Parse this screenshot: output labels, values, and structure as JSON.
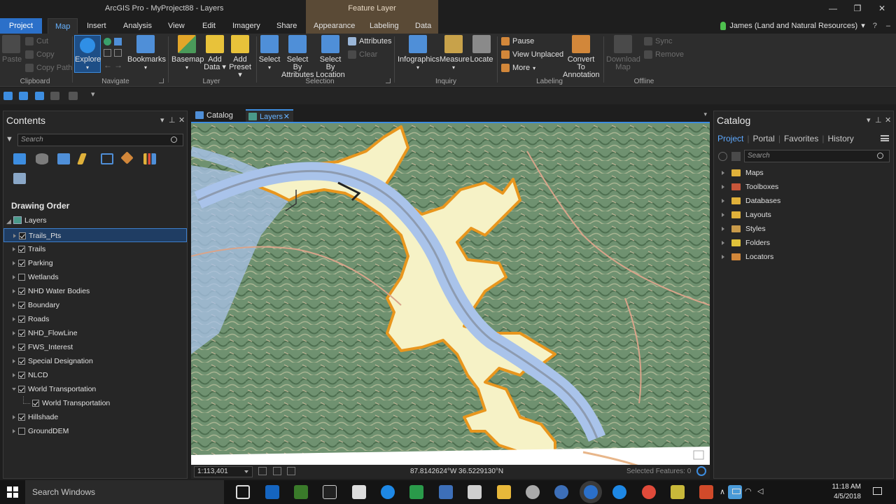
{
  "window": {
    "title": "ArcGIS Pro - MyProject88 - Layers",
    "context_group": "Feature Layer",
    "controls": {
      "minimize": "—",
      "restore": "❐",
      "close": "✕"
    }
  },
  "tabs": [
    "Project",
    "Map",
    "Insert",
    "Analysis",
    "View",
    "Edit",
    "Imagery",
    "Share",
    "Appearance",
    "Labeling",
    "Data"
  ],
  "active_tab": "Map",
  "user": {
    "name": "James (Land and Natural Resources)"
  },
  "ribbon": {
    "clipboard": {
      "paste": "Paste",
      "cut": "Cut",
      "copy": "Copy",
      "copy_path": "Copy Path",
      "label": "Clipboard"
    },
    "navigate": {
      "explore": "Explore",
      "bookmarks": "Bookmarks",
      "label": "Navigate"
    },
    "layer": {
      "basemap": "Basemap",
      "add_data_1": "Add",
      "add_data_2": "Data",
      "add_preset_1": "Add",
      "add_preset_2": "Preset",
      "label": "Layer"
    },
    "selection": {
      "select": "Select",
      "select_by_attr_1": "Select By",
      "select_by_attr_2": "Attributes",
      "select_by_loc_1": "Select By",
      "select_by_loc_2": "Location",
      "attributes": "Attributes",
      "clear": "Clear",
      "label": "Selection"
    },
    "inquiry": {
      "infographics": "Infographics",
      "measure": "Measure",
      "locate": "Locate",
      "label": "Inquiry"
    },
    "labeling": {
      "pause": "Pause",
      "view_unplaced": "View Unplaced",
      "more": "More",
      "convert_1": "Convert To",
      "convert_2": "Annotation",
      "label": "Labeling"
    },
    "offline": {
      "download_1": "Download",
      "download_2": "Map",
      "sync": "Sync",
      "remove": "Remove",
      "label": "Offline"
    }
  },
  "contents": {
    "title": "Contents",
    "search_placeholder": "Search",
    "section": "Drawing Order",
    "root": "Layers",
    "layers": [
      {
        "name": "Trails_Pts",
        "checked": true,
        "selected": true
      },
      {
        "name": "Trails",
        "checked": true
      },
      {
        "name": "Parking",
        "checked": true
      },
      {
        "name": "Wetlands",
        "checked": false
      },
      {
        "name": "NHD Water Bodies",
        "checked": true
      },
      {
        "name": "Boundary",
        "checked": true
      },
      {
        "name": "Roads",
        "checked": true
      },
      {
        "name": "NHD_FlowLine",
        "checked": true
      },
      {
        "name": "FWS_Interest",
        "checked": true
      },
      {
        "name": "Special Designation",
        "checked": true
      },
      {
        "name": "NLCD",
        "checked": true
      },
      {
        "name": "World Transportation",
        "checked": true,
        "expanded": true
      },
      {
        "name": "World Transportation",
        "checked": true,
        "child": true
      },
      {
        "name": "Hillshade",
        "checked": true
      },
      {
        "name": "GroundDEM",
        "checked": false
      }
    ]
  },
  "views": {
    "tabs": [
      {
        "label": "Catalog"
      },
      {
        "label": "Layers",
        "active": true
      }
    ]
  },
  "status": {
    "scale": "1:113,401",
    "coords": "87.8142624°W 36.5229130°N",
    "selected": "Selected Features: 0"
  },
  "catalog": {
    "title": "Catalog",
    "tabs": [
      "Project",
      "Portal",
      "Favorites",
      "History"
    ],
    "search_placeholder": "Search",
    "items": [
      "Maps",
      "Toolboxes",
      "Databases",
      "Layouts",
      "Styles",
      "Folders",
      "Locators"
    ]
  },
  "taskbar": {
    "search": "Search Windows",
    "time": "11:18 AM",
    "date": "4/5/2018"
  },
  "colors": {
    "accent": "#2b70c9",
    "active_tab_text": "#67b2ff",
    "boundary": "#e8961e",
    "wetland_fill": "#f6f2c6",
    "water": "#a9c3ea"
  }
}
